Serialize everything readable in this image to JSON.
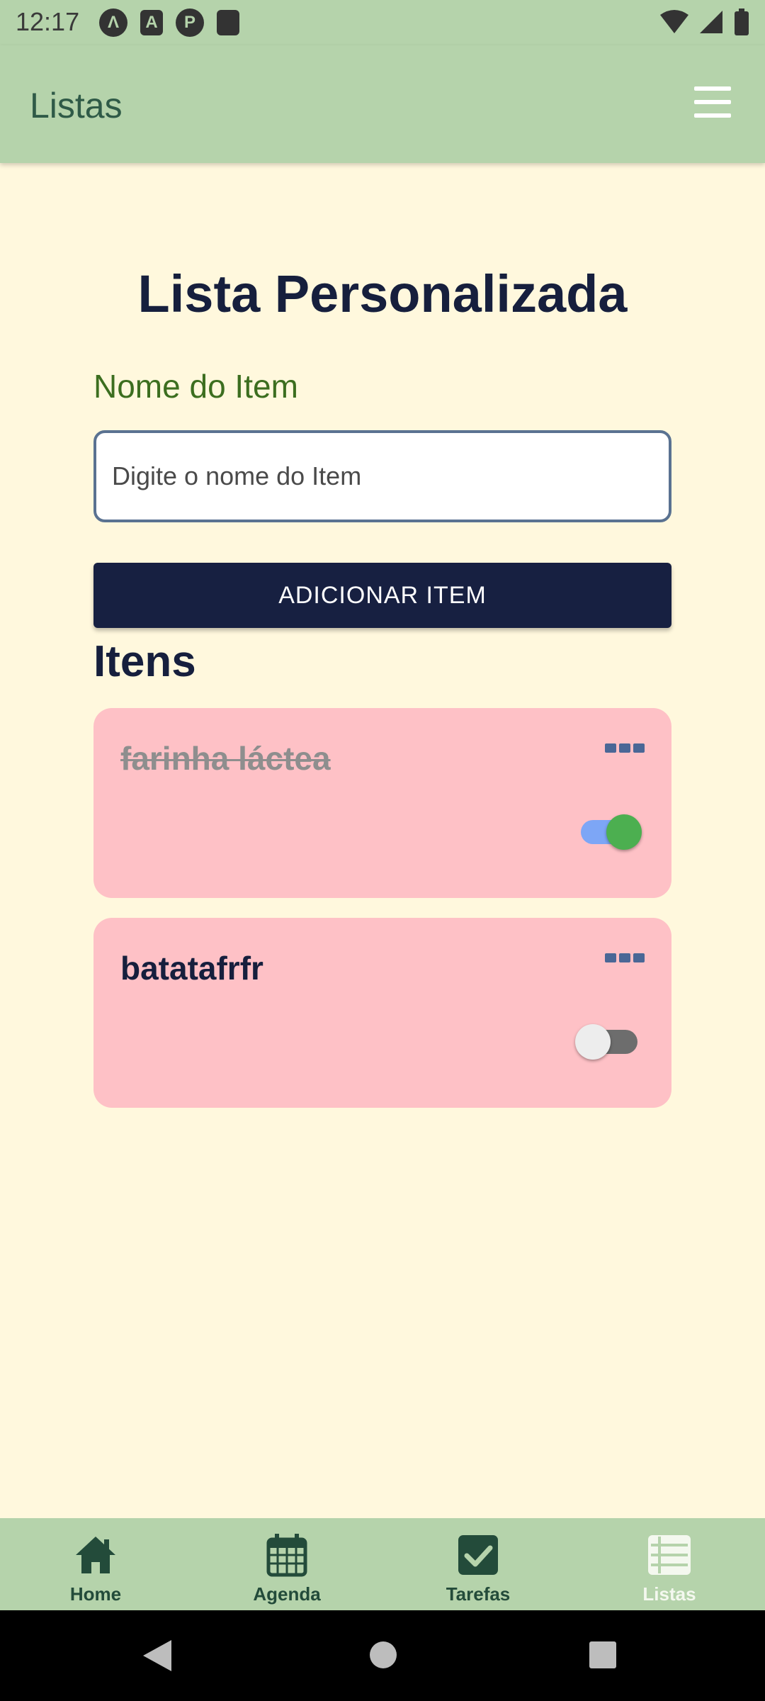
{
  "status_bar": {
    "time": "12:17",
    "left_icons": [
      "app-notification-icon",
      "a-badge-icon",
      "p-badge-icon",
      "sd-card-icon"
    ],
    "right_icons": [
      "wifi-icon",
      "signal-icon",
      "battery-icon"
    ]
  },
  "app_bar": {
    "title": "Listas",
    "menu_icon": "hamburger-menu-icon"
  },
  "main": {
    "page_title": "Lista Personalizada",
    "field_label": "Nome do Item",
    "input_placeholder": "Digite o nome do Item",
    "input_value": "",
    "add_button_label": "ADICIONAR ITEM",
    "section_title": "Itens",
    "items": [
      {
        "name": "farinha láctea",
        "done": true,
        "toggle_on": true
      },
      {
        "name": "batatafrfr",
        "done": false,
        "toggle_on": false
      }
    ]
  },
  "bottom_nav": {
    "items": [
      {
        "label": "Home",
        "icon": "home-icon",
        "active": false
      },
      {
        "label": "Agenda",
        "icon": "calendar-icon",
        "active": false
      },
      {
        "label": "Tarefas",
        "icon": "checkbox-icon",
        "active": false
      },
      {
        "label": "Listas",
        "icon": "list-icon",
        "active": true
      }
    ]
  },
  "colors": {
    "app_bar": "#B5D3AB",
    "background": "#FFF8DD",
    "primary_dark": "#161F3D",
    "card": "#FEC1C6",
    "toggle_on_thumb": "#4CAF50"
  }
}
